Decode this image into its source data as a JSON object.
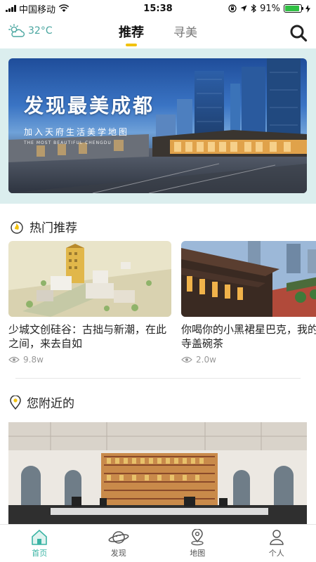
{
  "status": {
    "carrier": "中国移动",
    "time": "15:38",
    "battery": "91%",
    "battery_level": 0.91
  },
  "header": {
    "temperature": "32°C",
    "tabs": [
      {
        "label": "推荐",
        "active": true
      },
      {
        "label": "寻美",
        "active": false
      }
    ]
  },
  "banner": {
    "title": "发现最美成都",
    "subtitle": "加入天府生活美学地图",
    "english": "THE MOST BEAUTIFUL CHENGDU"
  },
  "hot": {
    "heading": "热门推荐",
    "cards": [
      {
        "title": "少城文创硅谷：古拙与新潮，在此之间，来去自如",
        "views": "9.8w"
      },
      {
        "title": "你喝你的小黑裙星巴克，我的大慈寺盖碗茶",
        "views": "2.0w"
      }
    ]
  },
  "nearby": {
    "heading": "您附近的"
  },
  "bottom_nav": [
    {
      "label": "首页",
      "icon": "home-icon",
      "active": true
    },
    {
      "label": "发现",
      "icon": "planet-icon",
      "active": false
    },
    {
      "label": "地图",
      "icon": "map-pin-icon",
      "active": false
    },
    {
      "label": "个人",
      "icon": "person-icon",
      "active": false
    }
  ],
  "colors": {
    "accent": "#3ab4a4",
    "tab_indicator": "#f2c20f",
    "banner_bg": "#dbeeee",
    "battery": "#2fc043"
  }
}
